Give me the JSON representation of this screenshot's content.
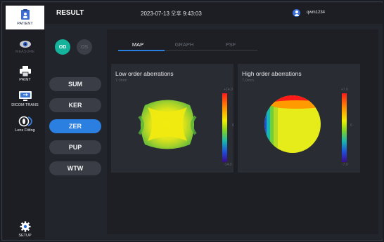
{
  "sidebar": {
    "items": [
      {
        "label": "PATIENT",
        "icon": "patient-icon",
        "state": "active"
      },
      {
        "label": "MEASURE",
        "icon": "eye-icon",
        "state": "disabled"
      },
      {
        "label": "PRINT",
        "icon": "printer-icon",
        "state": "normal"
      },
      {
        "label": "DICOM TRANS",
        "icon": "monitor-icon",
        "state": "normal"
      },
      {
        "label": "Lens Fitting",
        "icon": "lens-icon",
        "state": "normal"
      },
      {
        "label": "SETUP",
        "icon": "gear-icon",
        "state": "normal"
      }
    ]
  },
  "header": {
    "title": "RESULT",
    "datetime": "2023-07-13 오후 9:43:03",
    "username": "qwm1234"
  },
  "eye_selector": {
    "od": "OD",
    "os": "OS",
    "selected": "OD"
  },
  "modes": [
    {
      "label": "SUM",
      "active": false
    },
    {
      "label": "KER",
      "active": false
    },
    {
      "label": "ZER",
      "active": true
    },
    {
      "label": "PUP",
      "active": false
    },
    {
      "label": "WTW",
      "active": false
    }
  ],
  "tabs": [
    {
      "label": "MAP",
      "active": true
    },
    {
      "label": "GRAPH",
      "active": false
    },
    {
      "label": "PSF",
      "active": false
    }
  ],
  "maps": {
    "low": {
      "title": "Low order aberrations",
      "sub": "7.0mm",
      "scale_max": "+14.0",
      "scale_mid": "0",
      "scale_min": "-14.0"
    },
    "high": {
      "title": "High order aberrations",
      "sub": "7.0mm",
      "scale_max": "+7.0",
      "scale_mid": "0",
      "scale_min": "-7.0"
    }
  },
  "colors": {
    "accent": "#2b7fe0",
    "od_active": "#15b39b"
  }
}
